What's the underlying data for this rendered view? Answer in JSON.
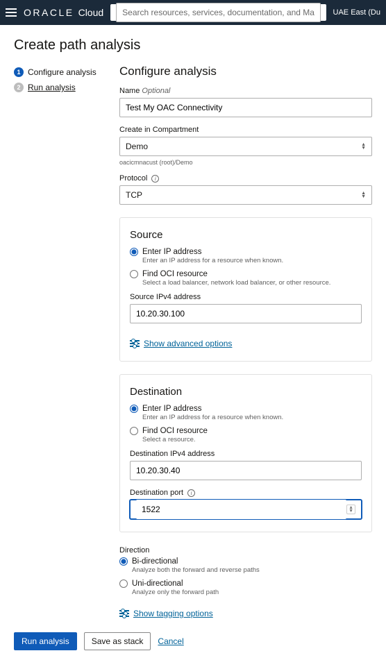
{
  "topbar": {
    "brand_main": "ORACLE",
    "brand_sub": "Cloud",
    "search_placeholder": "Search resources, services, documentation, and Marketplace",
    "region": "UAE East (Du"
  },
  "page_title": "Create path analysis",
  "steps": {
    "step1": {
      "num": "1",
      "label": "Configure analysis"
    },
    "step2": {
      "num": "2",
      "label": "Run analysis"
    }
  },
  "form": {
    "title": "Configure analysis",
    "name": {
      "label": "Name",
      "optional": "Optional",
      "value": "Test My OAC Connectivity"
    },
    "compartment": {
      "label": "Create in Compartment",
      "value": "Demo",
      "crumb": "oacicmnacust (root)/Demo"
    },
    "protocol": {
      "label": "Protocol",
      "value": "TCP"
    }
  },
  "source": {
    "title": "Source",
    "opt_ip": {
      "label": "Enter IP address",
      "help": "Enter an IP address for a resource when known."
    },
    "opt_res": {
      "label": "Find OCI resource",
      "help": "Select a load balancer, network load balancer, or other resource."
    },
    "ipv4": {
      "label": "Source IPv4 address",
      "value": "10.20.30.100"
    },
    "advanced": "Show advanced options"
  },
  "destination": {
    "title": "Destination",
    "opt_ip": {
      "label": "Enter IP address",
      "help": "Enter an IP address for a resource when known."
    },
    "opt_res": {
      "label": "Find OCI resource",
      "help": "Select a resource."
    },
    "ipv4": {
      "label": "Destination IPv4 address",
      "value": "10.20.30.40"
    },
    "port": {
      "label": "Destination port",
      "value": "1522"
    }
  },
  "direction": {
    "label": "Direction",
    "bi": {
      "label": "Bi-directional",
      "help": "Analyze both the forward and reverse paths"
    },
    "uni": {
      "label": "Uni-directional",
      "help": "Analyze only the forward path"
    },
    "tagging": "Show tagging options"
  },
  "actions": {
    "run": "Run analysis",
    "save": "Save as stack",
    "cancel": "Cancel"
  }
}
